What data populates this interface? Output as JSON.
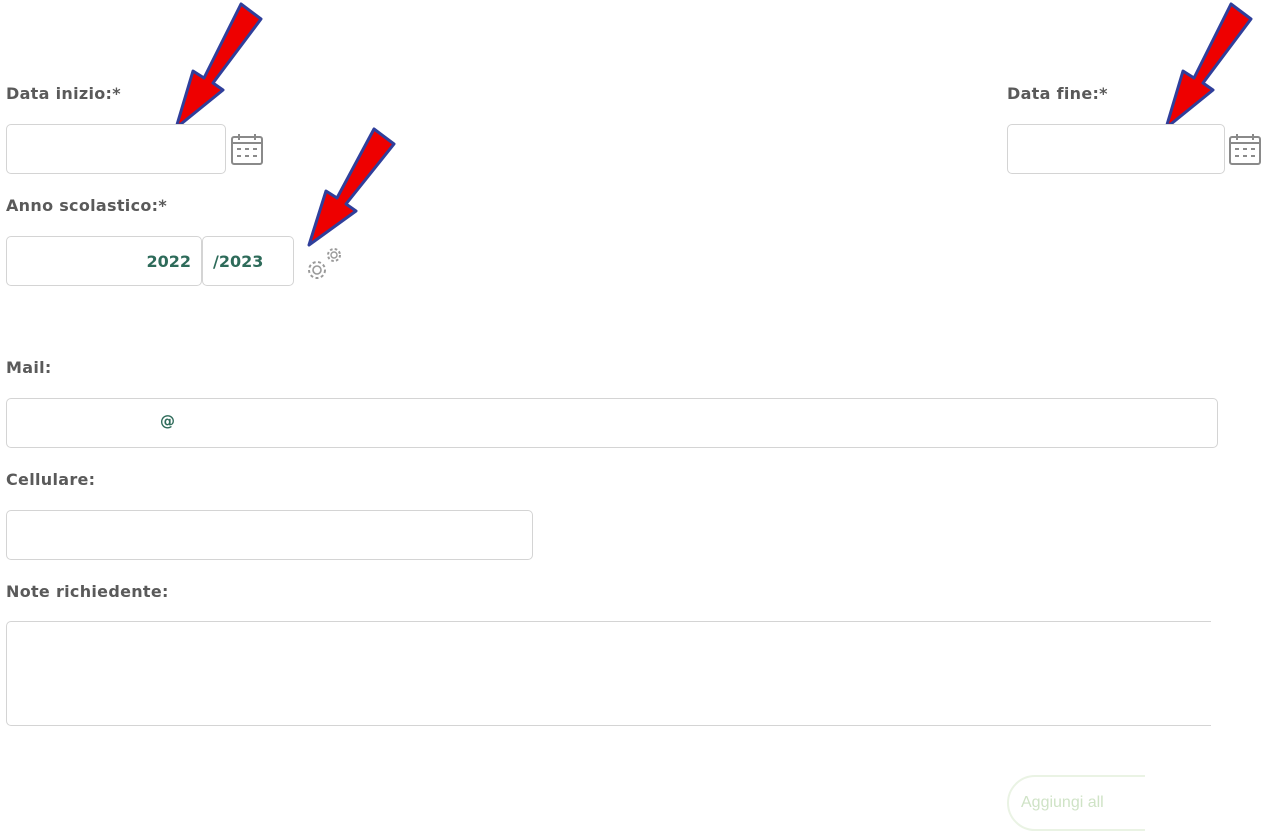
{
  "form": {
    "start_date": {
      "label": "Data inizio:*",
      "value": ""
    },
    "end_date": {
      "label": "Data fine:*",
      "value": ""
    },
    "school_year": {
      "label": "Anno scolastico:*",
      "start_value": "2022",
      "end_value": "/2023"
    },
    "mail": {
      "label": "Mail:",
      "value": "@"
    },
    "mobile": {
      "label": "Cellulare:",
      "value": ""
    },
    "notes": {
      "label": "Note richiedente:",
      "value": ""
    },
    "add_button": {
      "label": "Aggiungi all"
    }
  },
  "icons": {
    "calendar": "calendar-icon",
    "settings": "gears-icon",
    "annotation": "red-arrow-icon"
  },
  "colors": {
    "label_text": "#5a5a5a",
    "field_value": "#2e6b5a",
    "field_border": "#d4d4d4",
    "annotation_arrow": "#ee0000",
    "button_border": "#eaf3e4",
    "button_text": "#cfe3c6"
  }
}
